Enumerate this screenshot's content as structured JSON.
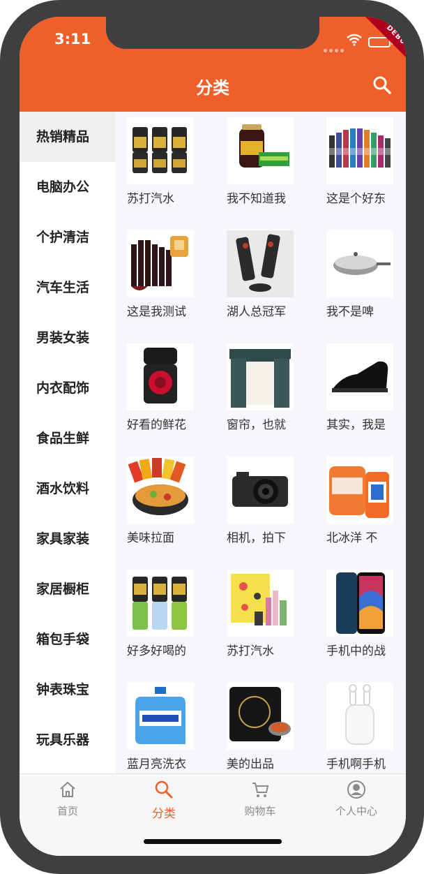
{
  "status_bar": {
    "time": "3:11",
    "debug_label": "DEBUG"
  },
  "header": {
    "title": "分类"
  },
  "sidebar": {
    "items": [
      {
        "label": "热销精品"
      },
      {
        "label": "电脑办公"
      },
      {
        "label": "个护清洁"
      },
      {
        "label": "汽车生活"
      },
      {
        "label": "男装女装"
      },
      {
        "label": "内衣配饰"
      },
      {
        "label": "食品生鲜"
      },
      {
        "label": "酒水饮料"
      },
      {
        "label": "家具家装"
      },
      {
        "label": "家居橱柜"
      },
      {
        "label": "箱包手袋"
      },
      {
        "label": "钟表珠宝"
      },
      {
        "label": "玩具乐器"
      }
    ]
  },
  "products": [
    {
      "name": "苏打汽水",
      "icon": "soda-cans-image"
    },
    {
      "name": "我不知道我",
      "icon": "jar-and-box-image"
    },
    {
      "name": "这是个好东",
      "icon": "bottles-row-image"
    },
    {
      "name": "这是我测试",
      "icon": "wine-bottles-image"
    },
    {
      "name": "湖人总冠军",
      "icon": "speakers-image"
    },
    {
      "name": "我不是啤",
      "icon": "wok-pan-image"
    },
    {
      "name": "好看的鲜花",
      "icon": "rose-box-image"
    },
    {
      "name": "窗帘，也就",
      "icon": "curtain-image"
    },
    {
      "name": "其实，我是",
      "icon": "leather-shoe-image"
    },
    {
      "name": "美味拉面",
      "icon": "noodles-image"
    },
    {
      "name": "相机，拍下",
      "icon": "camera-image"
    },
    {
      "name": "北冰洋 不",
      "icon": "orange-soda-image"
    },
    {
      "name": "好多好喝的",
      "icon": "soda-cans-image"
    },
    {
      "name": "苏打汽水",
      "icon": "cosmetics-image"
    },
    {
      "name": "手机中的战",
      "icon": "smartphone-image"
    },
    {
      "name": "蓝月亮洗衣",
      "icon": "detergent-image"
    },
    {
      "name": "美的出品",
      "icon": "induction-cooker-image"
    },
    {
      "name": "手机啊手机",
      "icon": "earbuds-image"
    }
  ],
  "tabbar": {
    "items": [
      {
        "label": "首页",
        "icon": "home-icon"
      },
      {
        "label": "分类",
        "icon": "search-icon"
      },
      {
        "label": "购物车",
        "icon": "cart-icon"
      },
      {
        "label": "个人中心",
        "icon": "user-icon"
      }
    ]
  },
  "colors": {
    "accent": "#ef5f29",
    "active_sidebar": "#efefef",
    "debug_banner": "#b00020"
  }
}
